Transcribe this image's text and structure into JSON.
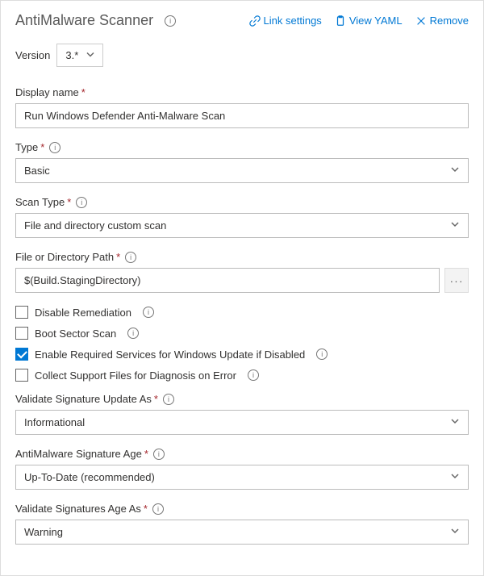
{
  "header": {
    "title": "AntiMalware Scanner",
    "actions": {
      "link_settings": "Link settings",
      "view_yaml": "View YAML",
      "remove": "Remove"
    }
  },
  "version": {
    "label": "Version",
    "value": "3.*"
  },
  "fields": {
    "display_name": {
      "label": "Display name",
      "value": "Run Windows Defender Anti-Malware Scan"
    },
    "type": {
      "label": "Type",
      "value": "Basic"
    },
    "scan_type": {
      "label": "Scan Type",
      "value": "File and directory custom scan"
    },
    "path": {
      "label": "File or Directory Path",
      "value": "$(Build.StagingDirectory)"
    },
    "validate_sig_update": {
      "label": "Validate Signature Update As",
      "value": "Informational"
    },
    "sig_age": {
      "label": "AntiMalware Signature Age",
      "value": "Up-To-Date (recommended)"
    },
    "validate_sig_age": {
      "label": "Validate Signatures Age As",
      "value": "Warning"
    }
  },
  "checkboxes": {
    "disable_remediation": {
      "label": "Disable Remediation",
      "checked": false
    },
    "boot_sector": {
      "label": "Boot Sector Scan",
      "checked": false
    },
    "enable_services": {
      "label": "Enable Required Services for Windows Update if Disabled",
      "checked": true
    },
    "collect_support": {
      "label": "Collect Support Files for Diagnosis on Error",
      "checked": false
    }
  }
}
